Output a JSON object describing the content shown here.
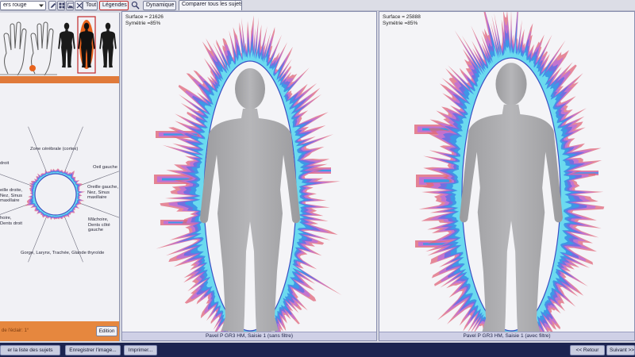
{
  "toolbar": {
    "color_select": "ers rouge",
    "all_button": "Tout",
    "legend_button": "Légendes",
    "dynamic_button": "Dynamique",
    "compare_tab": "Comparer tous les sujets",
    "icons": [
      "chevron-down-icon",
      "edit-icon",
      "grid-icon",
      "image-icon",
      "close-icon",
      "search-icon"
    ]
  },
  "sidebar": {
    "sector_labels": {
      "cortex": "Zone cérébrale (cortex)",
      "right_eye": "droit",
      "left_eye": "Oeil gauche",
      "right_ear": "eille droite, Nez, Sinus maxillaire",
      "left_ear": "Oreille gauche, Nez, Sinus maxillaire",
      "right_jaw": "hoire, Dents droit",
      "left_jaw": "Mâchoire, Dents côté gauche",
      "throat": "Gorge, Larynx, Trachée, Glande thyroïde"
    },
    "bottom_text": "de l'éclair: 1°",
    "edit_button": "Edition"
  },
  "images": [
    {
      "surface": "Surface = 21626",
      "symmetry": "Symétrie =85%",
      "caption": "Pavel P GR3 HM, Saisie 1 (sans filtre)"
    },
    {
      "surface": "Surface = 25888",
      "symmetry": "Symétrie =85%",
      "caption": "Pavel P GR3 HM, Saisie 1 (avec filtre)"
    }
  ],
  "footer": {
    "subject_list": "er la liste des sujets",
    "save_image": "Enregistrer l'image...",
    "print": "Imprimer...",
    "back": "<< Retour",
    "next": "Suivant >>"
  },
  "colors": {
    "aura": [
      "#e0667a",
      "#c072d4",
      "#6a70e2",
      "#3a9ae6",
      "#6fe0f0"
    ],
    "aura_inner_edge": "#3b4fc4",
    "field_background": "#f4f4f7",
    "highlight": "#e8641e",
    "selection_border": "#c0282a"
  }
}
